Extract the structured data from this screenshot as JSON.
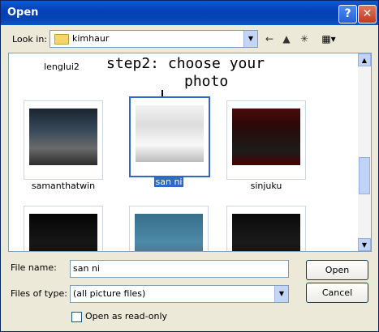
{
  "window": {
    "title": "Open",
    "help_glyph": "?",
    "close_glyph": "✕"
  },
  "lookin": {
    "label": "Look in:",
    "value": "kimhaur"
  },
  "annotation": {
    "line1": "step2: choose your",
    "line2": "photo"
  },
  "files": {
    "top_row": [
      "lenglui2",
      "..."
    ],
    "items": [
      {
        "name": "samanthatwin",
        "selected": false
      },
      {
        "name": "san ni",
        "selected": true
      },
      {
        "name": "sinjuku",
        "selected": false
      }
    ]
  },
  "form": {
    "filename_label": "File name:",
    "filename_value": "san ni",
    "filetype_label": "Files of type:",
    "filetype_value": "(all picture files)",
    "readonly_label": "Open as read-only"
  },
  "buttons": {
    "open": "Open",
    "cancel": "Cancel"
  }
}
